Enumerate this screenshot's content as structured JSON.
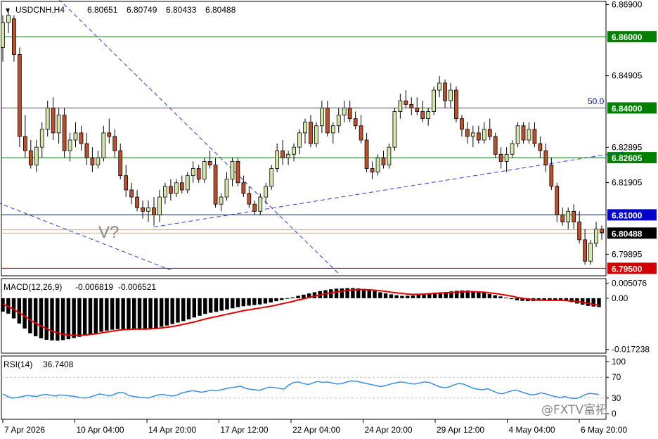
{
  "header": {
    "symbol": "USDCNH,H4",
    "open": "6.80651",
    "high": "6.80749",
    "low": "6.80433",
    "close": "6.80488"
  },
  "annotations": {
    "v_mark": "V?",
    "fib_label": "50.0"
  },
  "watermark": {
    "text": "@FXTV富拓"
  },
  "colors": {
    "bull_body": "#d6e8a8",
    "bear_body": "#c0502a",
    "wick": "#000000",
    "level_green": "#008000",
    "level_blue": "#0000cc",
    "level_red": "#d00000",
    "price_tag": "#000000",
    "macd_signal": "#e00000",
    "rsi_line": "#3a8ee6",
    "trend_line": "#2b3fd6"
  },
  "chart_data": [
    {
      "type": "candlestick",
      "title": "USDCNH,H4",
      "ylim": [
        6.7929,
        6.8699
      ],
      "price_ticks": [
        "6.86900",
        "6.84905",
        "6.82895",
        "6.81905",
        "6.79895"
      ],
      "price_tick_values": [
        6.869,
        6.84905,
        6.82895,
        6.81905,
        6.79895
      ],
      "levels": [
        {
          "label": "6.86000",
          "value": 6.86,
          "color": "green"
        },
        {
          "label": "6.84000",
          "value": 6.84,
          "color": "green"
        },
        {
          "label": "6.82605",
          "value": 6.82605,
          "color": "green"
        },
        {
          "label": "6.81000",
          "value": 6.81,
          "color": "blue"
        },
        {
          "label": "6.80488",
          "value": 6.80488,
          "color": "black"
        },
        {
          "label": "6.79500",
          "value": 6.795,
          "color": "red"
        }
      ],
      "x_ticks": [
        "7 Apr 2026",
        "10 Apr 04:00",
        "14 Apr 20:00",
        "17 Apr 12:00",
        "22 Apr 04:00",
        "24 Apr 20:00",
        "29 Apr 12:00",
        "4 May 04:00",
        "6 May 20:00"
      ],
      "ohlc": [
        [
          6.857,
          6.866,
          6.853,
          6.864
        ],
        [
          6.864,
          6.868,
          6.861,
          6.866
        ],
        [
          6.865,
          6.866,
          6.853,
          6.855
        ],
        [
          6.855,
          6.857,
          6.829,
          6.832
        ],
        [
          6.832,
          6.838,
          6.826,
          6.828
        ],
        [
          6.828,
          6.831,
          6.823,
          6.824
        ],
        [
          6.824,
          6.831,
          6.822,
          6.829
        ],
        [
          6.829,
          6.836,
          6.826,
          6.834
        ],
        [
          6.834,
          6.842,
          6.832,
          6.84
        ],
        [
          6.84,
          6.843,
          6.831,
          6.833
        ],
        [
          6.833,
          6.84,
          6.83,
          6.838
        ],
        [
          6.838,
          6.84,
          6.826,
          6.828
        ],
        [
          6.828,
          6.833,
          6.825,
          6.831
        ],
        [
          6.831,
          6.836,
          6.829,
          6.833
        ],
        [
          6.833,
          6.835,
          6.828,
          6.83
        ],
        [
          6.83,
          6.833,
          6.824,
          6.826
        ],
        [
          6.826,
          6.829,
          6.822,
          6.824
        ],
        [
          6.824,
          6.828,
          6.823,
          6.826
        ],
        [
          6.826,
          6.835,
          6.825,
          6.833
        ],
        [
          6.833,
          6.837,
          6.83,
          6.832
        ],
        [
          6.832,
          6.834,
          6.826,
          6.828
        ],
        [
          6.828,
          6.83,
          6.82,
          6.821
        ],
        [
          6.821,
          6.824,
          6.815,
          6.817
        ],
        [
          6.817,
          6.819,
          6.813,
          6.815
        ],
        [
          6.815,
          6.817,
          6.811,
          6.812
        ],
        [
          6.812,
          6.814,
          6.809,
          6.811
        ],
        [
          6.811,
          6.814,
          6.808,
          6.812
        ],
        [
          6.812,
          6.815,
          6.807,
          6.81
        ],
        [
          6.81,
          6.817,
          6.808,
          6.815
        ],
        [
          6.815,
          6.819,
          6.813,
          6.818
        ],
        [
          6.818,
          6.82,
          6.814,
          6.816
        ],
        [
          6.816,
          6.82,
          6.815,
          6.819
        ],
        [
          6.819,
          6.821,
          6.816,
          6.817
        ],
        [
          6.817,
          6.822,
          6.816,
          6.821
        ],
        [
          6.821,
          6.825,
          6.819,
          6.823
        ],
        [
          6.823,
          6.824,
          6.819,
          6.82
        ],
        [
          6.82,
          6.826,
          6.819,
          6.825
        ],
        [
          6.825,
          6.828,
          6.823,
          6.824
        ],
        [
          6.824,
          6.826,
          6.812,
          6.813
        ],
        [
          6.813,
          6.816,
          6.811,
          6.815
        ],
        [
          6.815,
          6.822,
          6.814,
          6.82
        ],
        [
          6.82,
          6.826,
          6.818,
          6.825
        ],
        [
          6.825,
          6.826,
          6.818,
          6.819
        ],
        [
          6.819,
          6.821,
          6.815,
          6.816
        ],
        [
          6.816,
          6.818,
          6.812,
          6.813
        ],
        [
          6.813,
          6.814,
          6.81,
          6.811
        ],
        [
          6.811,
          6.816,
          6.81,
          6.815
        ],
        [
          6.815,
          6.819,
          6.813,
          6.818
        ],
        [
          6.818,
          6.824,
          6.817,
          6.823
        ],
        [
          6.823,
          6.83,
          6.822,
          6.828
        ],
        [
          6.828,
          6.831,
          6.824,
          6.826
        ],
        [
          6.826,
          6.828,
          6.824,
          6.827
        ],
        [
          6.827,
          6.83,
          6.825,
          6.829
        ],
        [
          6.829,
          6.834,
          6.827,
          6.833
        ],
        [
          6.833,
          6.837,
          6.83,
          6.836
        ],
        [
          6.836,
          6.838,
          6.829,
          6.83
        ],
        [
          6.83,
          6.836,
          6.829,
          6.835
        ],
        [
          6.835,
          6.842,
          6.833,
          6.84
        ],
        [
          6.84,
          6.842,
          6.832,
          6.833
        ],
        [
          6.833,
          6.836,
          6.83,
          6.835
        ],
        [
          6.835,
          6.84,
          6.833,
          6.838
        ],
        [
          6.838,
          6.842,
          6.836,
          6.84
        ],
        [
          6.84,
          6.842,
          6.836,
          6.837
        ],
        [
          6.837,
          6.839,
          6.834,
          6.835
        ],
        [
          6.835,
          6.838,
          6.83,
          6.831
        ],
        [
          6.831,
          6.833,
          6.822,
          6.823
        ],
        [
          6.823,
          6.825,
          6.82,
          6.822
        ],
        [
          6.822,
          6.827,
          6.821,
          6.826
        ],
        [
          6.826,
          6.828,
          6.823,
          6.824
        ],
        [
          6.824,
          6.83,
          6.823,
          6.829
        ],
        [
          6.829,
          6.84,
          6.828,
          6.839
        ],
        [
          6.839,
          6.844,
          6.837,
          6.842
        ],
        [
          6.842,
          6.845,
          6.84,
          6.841
        ],
        [
          6.841,
          6.843,
          6.838,
          6.84
        ],
        [
          6.84,
          6.843,
          6.838,
          6.839
        ],
        [
          6.839,
          6.842,
          6.836,
          6.837
        ],
        [
          6.837,
          6.84,
          6.835,
          6.839
        ],
        [
          6.839,
          6.846,
          6.838,
          6.845
        ],
        [
          6.845,
          6.849,
          6.843,
          6.847
        ],
        [
          6.847,
          6.848,
          6.84,
          6.842
        ],
        [
          6.842,
          6.847,
          6.84,
          6.845
        ],
        [
          6.845,
          6.846,
          6.836,
          6.837
        ],
        [
          6.837,
          6.838,
          6.832,
          6.834
        ],
        [
          6.834,
          6.836,
          6.83,
          6.832
        ],
        [
          6.832,
          6.835,
          6.829,
          6.833
        ],
        [
          6.833,
          6.835,
          6.83,
          6.831
        ],
        [
          6.831,
          6.836,
          6.83,
          6.834
        ],
        [
          6.834,
          6.837,
          6.831,
          6.832
        ],
        [
          6.832,
          6.833,
          6.826,
          6.827
        ],
        [
          6.827,
          6.829,
          6.823,
          6.825
        ],
        [
          6.825,
          6.829,
          6.822,
          6.827
        ],
        [
          6.827,
          6.831,
          6.826,
          6.83
        ],
        [
          6.83,
          6.836,
          6.829,
          6.835
        ],
        [
          6.835,
          6.836,
          6.83,
          6.831
        ],
        [
          6.831,
          6.836,
          6.83,
          6.834
        ],
        [
          6.834,
          6.836,
          6.829,
          6.83
        ],
        [
          6.83,
          6.832,
          6.826,
          6.828
        ],
        [
          6.828,
          6.83,
          6.822,
          6.824
        ],
        [
          6.824,
          6.826,
          6.817,
          6.818
        ],
        [
          6.818,
          6.819,
          6.808,
          6.81
        ],
        [
          6.81,
          6.812,
          6.807,
          6.808
        ],
        [
          6.808,
          6.812,
          6.806,
          6.811
        ],
        [
          6.811,
          6.813,
          6.806,
          6.808
        ],
        [
          6.808,
          6.811,
          6.802,
          6.803
        ],
        [
          6.803,
          6.806,
          6.796,
          6.797
        ],
        [
          6.797,
          6.803,
          6.796,
          6.802
        ],
        [
          6.802,
          6.808,
          6.801,
          6.806
        ],
        [
          6.806,
          6.807,
          6.803,
          6.805
        ]
      ]
    },
    {
      "type": "histogram",
      "title": "MACD(12,26,9)",
      "macd_value": "-0.006819",
      "signal_value": "-0.006521",
      "ticks": [
        "0.005076",
        "0.00",
        "-0.017238"
      ],
      "tick_values": [
        0.005076,
        0.0,
        -0.017238
      ],
      "ylim": [
        -0.0185,
        0.0066
      ],
      "histogram": [
        -0.0045,
        -0.0052,
        -0.0068,
        -0.0085,
        -0.0102,
        -0.0118,
        -0.0128,
        -0.0135,
        -0.014,
        -0.0142,
        -0.0143,
        -0.0141,
        -0.0138,
        -0.0134,
        -0.013,
        -0.0126,
        -0.0122,
        -0.0118,
        -0.0113,
        -0.0109,
        -0.0106,
        -0.0104,
        -0.0104,
        -0.0105,
        -0.0106,
        -0.0106,
        -0.0105,
        -0.0103,
        -0.01,
        -0.0096,
        -0.0092,
        -0.0087,
        -0.0082,
        -0.0077,
        -0.0071,
        -0.0065,
        -0.0059,
        -0.0053,
        -0.0049,
        -0.0046,
        -0.0042,
        -0.0038,
        -0.0034,
        -0.003,
        -0.0027,
        -0.0025,
        -0.0023,
        -0.0021,
        -0.0018,
        -0.0014,
        -0.001,
        -0.0006,
        -0.0002,
        0.0003,
        0.0008,
        0.0012,
        0.0016,
        0.002,
        0.0024,
        0.0027,
        0.003,
        0.0032,
        0.0033,
        0.0034,
        0.0034,
        0.0033,
        0.0031,
        0.0028,
        0.0024,
        0.002,
        0.0016,
        0.0013,
        0.001,
        0.0008,
        0.0008,
        0.0009,
        0.0011,
        0.0014,
        0.0017,
        0.0019,
        0.002,
        0.0021,
        0.0023,
        0.0025,
        0.0026,
        0.0026,
        0.0024,
        0.0021,
        0.0018,
        0.0014,
        0.001,
        0.0006,
        0.0002,
        -0.0003,
        -0.0007,
        -0.0009,
        -0.001,
        -0.001,
        -0.0009,
        -0.0007,
        -0.0006,
        -0.0006,
        -0.0007,
        -0.0009,
        -0.0013,
        -0.0018,
        -0.0022,
        -0.0026,
        -0.0028,
        -0.003
      ],
      "signal": [
        -0.002,
        -0.0028,
        -0.0038,
        -0.0049,
        -0.0061,
        -0.0073,
        -0.0084,
        -0.0094,
        -0.0103,
        -0.0111,
        -0.0117,
        -0.0121,
        -0.0124,
        -0.0125,
        -0.0125,
        -0.0124,
        -0.0122,
        -0.012,
        -0.0117,
        -0.0114,
        -0.0111,
        -0.0108,
        -0.0106,
        -0.0105,
        -0.0104,
        -0.0104,
        -0.0104,
        -0.0103,
        -0.0102,
        -0.01,
        -0.0098,
        -0.0095,
        -0.0092,
        -0.0088,
        -0.0084,
        -0.008,
        -0.0075,
        -0.007,
        -0.0066,
        -0.0062,
        -0.0058,
        -0.0054,
        -0.005,
        -0.0046,
        -0.0042,
        -0.0039,
        -0.0036,
        -0.0033,
        -0.003,
        -0.0027,
        -0.0023,
        -0.0019,
        -0.0015,
        -0.0011,
        -0.0006,
        -0.0002,
        0.0003,
        0.0007,
        0.0011,
        0.0015,
        0.0018,
        0.0021,
        0.0024,
        0.0026,
        0.0028,
        0.0029,
        0.0029,
        0.0028,
        0.0027,
        0.0025,
        0.0023,
        0.002,
        0.0018,
        0.0016,
        0.0014,
        0.0013,
        0.0013,
        0.0014,
        0.0015,
        0.0016,
        0.0017,
        0.0018,
        0.0019,
        0.002,
        0.0021,
        0.0022,
        0.0022,
        0.0021,
        0.002,
        0.0018,
        0.0016,
        0.0013,
        0.001,
        0.0007,
        0.0003,
        0.0,
        -0.0003,
        -0.0005,
        -0.0006,
        -0.0007,
        -0.0007,
        -0.0007,
        -0.0007,
        -0.0008,
        -0.0009,
        -0.0011,
        -0.0014,
        -0.0017,
        -0.0021,
        -0.0024
      ]
    },
    {
      "type": "line",
      "title": "RSI(14)",
      "rsi_value": "36.7408",
      "ticks": [
        "100",
        "70",
        "30",
        "0"
      ],
      "tick_values": [
        100,
        70,
        30,
        0
      ],
      "ylim": [
        0,
        100
      ],
      "values": [
        38,
        33,
        30,
        31,
        33,
        35,
        34,
        33,
        36,
        37,
        35,
        34,
        36,
        35,
        34,
        33,
        31,
        30,
        32,
        35,
        38,
        36,
        34,
        37,
        41,
        40,
        35,
        33,
        32,
        31,
        30,
        33,
        36,
        37,
        35,
        34,
        36,
        40,
        42,
        44,
        43,
        41,
        43,
        45,
        44,
        46,
        48,
        50,
        51,
        53,
        49,
        47,
        46,
        45,
        48,
        51,
        50,
        49,
        47,
        55,
        60,
        61,
        58,
        56,
        59,
        62,
        60,
        61,
        59,
        57,
        58,
        61,
        63,
        62,
        60,
        58,
        56,
        54,
        52,
        54,
        57,
        59,
        61,
        60,
        58,
        57,
        59,
        61,
        60,
        56,
        52,
        50,
        51,
        55,
        58,
        57,
        53,
        49,
        47,
        46,
        48,
        44,
        40,
        38,
        41,
        44,
        45,
        42,
        39,
        36,
        37,
        40,
        38,
        35,
        33,
        31,
        33,
        30,
        29,
        31,
        36,
        39,
        38,
        37
      ]
    }
  ]
}
